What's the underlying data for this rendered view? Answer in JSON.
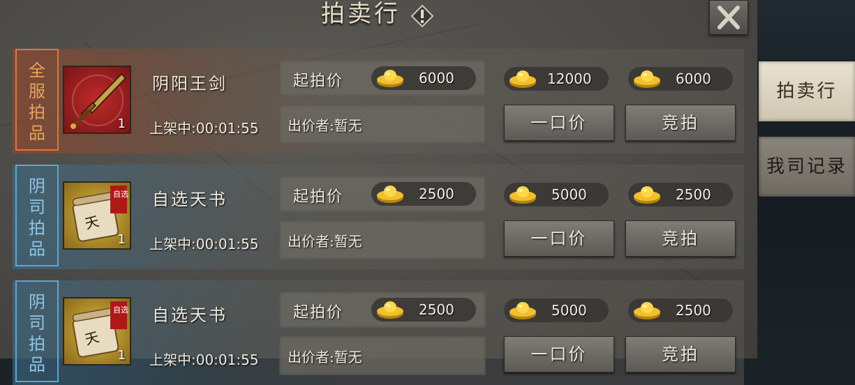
{
  "header": {
    "title": "拍卖行",
    "info_icon": "info-icon",
    "close_icon": "close-icon"
  },
  "tabs": [
    {
      "label": "拍卖行",
      "active": true
    },
    {
      "label": "我司记录",
      "active": false
    }
  ],
  "currency_icon": "gold-ingot-icon",
  "rows": [
    {
      "category": "全服拍品",
      "category_chars": [
        "全",
        "服",
        "拍",
        "品"
      ],
      "theme": "red",
      "item_name": "阴阳王剑",
      "item_icon": "sword-icon",
      "quantity": "1",
      "timer": "上架中:00:01:55",
      "start_price_label": "起拍价",
      "start_price": "6000",
      "buyout_price": "12000",
      "bid_price": "6000",
      "bidder": "出价者:暂无",
      "buyout_button": "一口价",
      "bid_button": "竞拍"
    },
    {
      "category": "阴司拍品",
      "category_chars": [
        "阴",
        "司",
        "拍",
        "品"
      ],
      "theme": "blue",
      "item_name": "自选天书",
      "item_icon": "scroll-icon",
      "item_badge": "自选",
      "quantity": "1",
      "timer": "上架中:00:01:55",
      "start_price_label": "起拍价",
      "start_price": "2500",
      "buyout_price": "5000",
      "bid_price": "2500",
      "bidder": "出价者:暂无",
      "buyout_button": "一口价",
      "bid_button": "竞拍"
    },
    {
      "category": "阴司拍品",
      "category_chars": [
        "阴",
        "司",
        "拍",
        "品"
      ],
      "theme": "blue",
      "item_name": "自选天书",
      "item_icon": "scroll-icon",
      "item_badge": "自选",
      "quantity": "1",
      "timer": "上架中:00:01:55",
      "start_price_label": "起拍价",
      "start_price": "2500",
      "buyout_price": "5000",
      "bid_price": "2500",
      "bidder": "出价者:暂无",
      "buyout_button": "一口价",
      "bid_button": "竞拍"
    }
  ]
}
